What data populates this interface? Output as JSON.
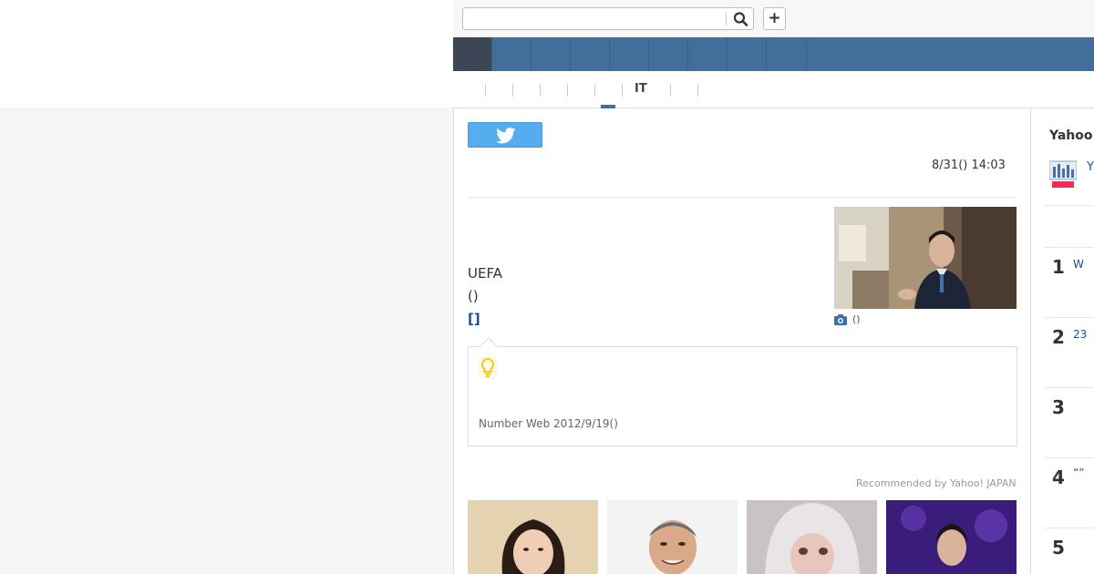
{
  "search": {
    "placeholder": ""
  },
  "header": {
    "add_label": "+"
  },
  "category_tabs": {
    "active_label": "IT"
  },
  "article": {
    "date": "8/31() 14:03",
    "body_line1": "UEFA",
    "body_line2": "()",
    "more_link": "[]",
    "photo_caption": "()",
    "tip_source": "Number Web 2012/9/19()"
  },
  "recommend": {
    "label": "Recommended by Yahoo! JAPAN"
  },
  "sidebar": {
    "title": "Yahoo",
    "logo_text": "Y",
    "ranking": [
      {
        "rank": "1",
        "text": "W"
      },
      {
        "rank": "2",
        "text": "23"
      },
      {
        "rank": "3",
        "text": ""
      },
      {
        "rank": "4",
        "text": "“”"
      },
      {
        "rank": "5",
        "text": ""
      }
    ]
  },
  "colors": {
    "nav_blue": "#416f9c",
    "nav_active": "#3c4655",
    "twitter_blue": "#55acee",
    "link_blue": "#1a4d9e",
    "bulb_yellow": "#f4c20d"
  },
  "icons": {
    "search": "search-icon",
    "twitter": "twitter-bird-icon",
    "camera": "camera-icon",
    "bulb": "lightbulb-icon"
  }
}
